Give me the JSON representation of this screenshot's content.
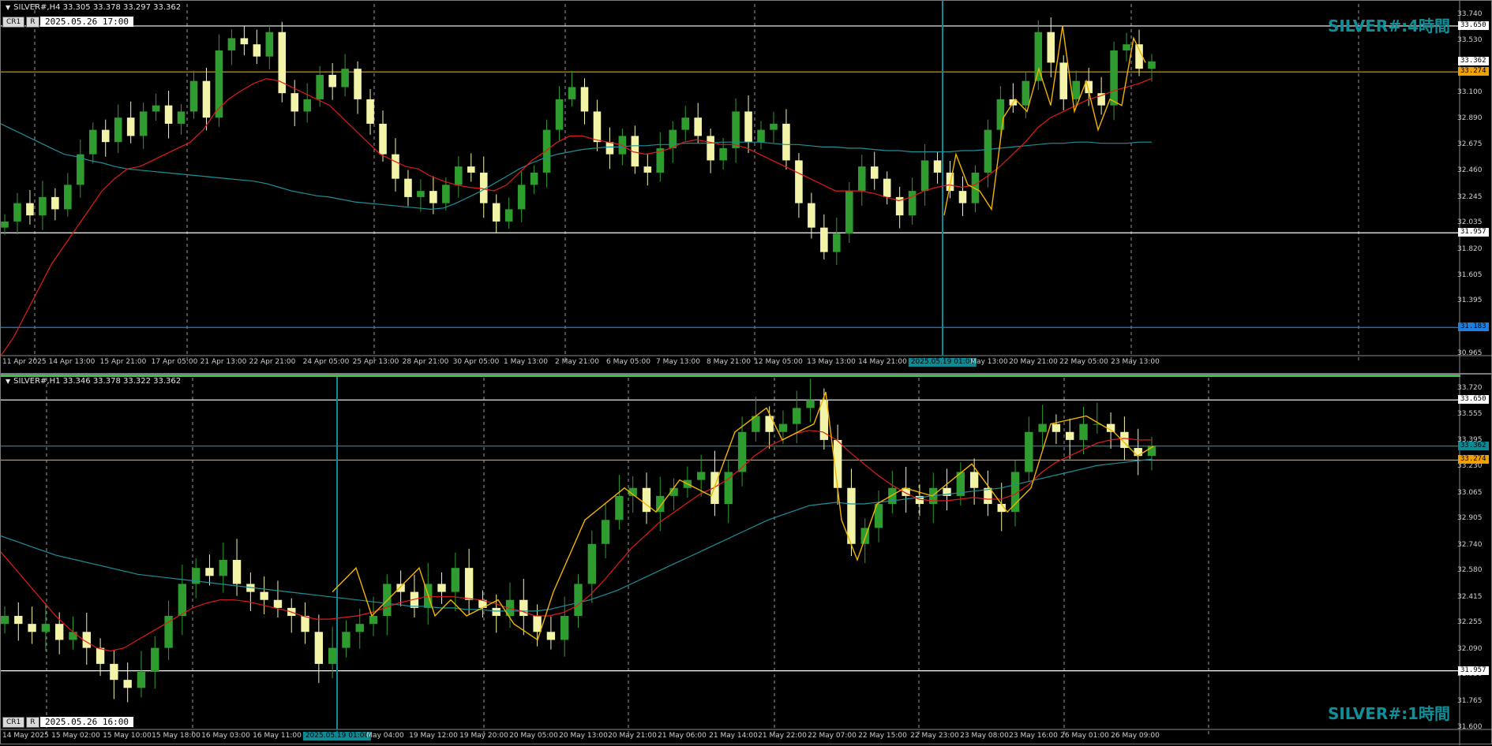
{
  "colors": {
    "background": "#000000",
    "bull_candle": "#2e9c2e",
    "bear_candle": "#f4f4a8",
    "ma_fast": "#e01b1b",
    "ma_slow": "#1f8f98",
    "zigzag": "#f0b400",
    "level_orange": "#f0a000",
    "level_white": "#ffffff",
    "level_blue": "#1e7fe0",
    "crosshair": "#0e8a95",
    "title": "#0f8f9a"
  },
  "top_chart": {
    "info": "SILVER#,H4  33.305 33.378 33.297 33.362",
    "btn_cr": "CR1",
    "btn_r": "R",
    "timestamp": "2025.05.26 17:00",
    "title": "SILVER#:4時間",
    "price_min": 30.965,
    "price_max": 33.74,
    "y_ticks": [
      "33.740",
      "33.530",
      "33.100",
      "32.890",
      "32.675",
      "32.460",
      "32.245",
      "32.035",
      "31.820",
      "31.605",
      "31.395",
      "30.965"
    ],
    "tags": [
      {
        "label": "33.650",
        "value": 33.65,
        "bg": "#ffffff",
        "fg": "#000000"
      },
      {
        "label": "33.362",
        "value": 33.362,
        "bg": "#ffffff",
        "fg": "#000000"
      },
      {
        "label": "33.274",
        "value": 33.274,
        "bg": "#f0a000",
        "fg": "#000000"
      },
      {
        "label": "31.957",
        "value": 31.957,
        "bg": "#ffffff",
        "fg": "#000000"
      },
      {
        "label": "31.183",
        "value": 31.183,
        "bg": "#1e7fe0",
        "fg": "#000000"
      }
    ],
    "levels": [
      {
        "value": 33.65,
        "color": "#ffffff"
      },
      {
        "value": 33.274,
        "color": "#f0a000"
      },
      {
        "value": 31.957,
        "color": "#ffffff"
      },
      {
        "value": 31.183,
        "color": "#1e7fe0"
      }
    ],
    "x_labels": [
      "11 Apr 2025",
      "14 Apr 13:00",
      "15 Apr 21:00",
      "17 Apr 05:00",
      "21 Apr 13:00",
      "22 Apr 21:00",
      "24 Apr 05:00",
      "25 Apr 13:00",
      "28 Apr 21:00",
      "30 Apr 05:00",
      "1 May 13:00",
      "2 May 21:00",
      "6 May 05:00",
      "7 May 13:00",
      "8 May 21:00",
      "12 May 05:00",
      "13 May 13:00",
      "14 May 21:00",
      "2025.05.19 01:00",
      "May 13:00",
      "20 May 21:00",
      "22 May 05:00",
      "23 May 13:00"
    ],
    "crosshair_label": "2025.05.19 01:00",
    "close_path": [
      32.05,
      32.2,
      32.1,
      32.25,
      32.15,
      32.35,
      32.6,
      32.8,
      32.7,
      32.9,
      32.75,
      32.95,
      33.0,
      32.85,
      32.95,
      33.2,
      32.9,
      33.45,
      33.55,
      33.5,
      33.4,
      33.6,
      33.1,
      32.95,
      33.05,
      33.25,
      33.15,
      33.3,
      33.05,
      32.85,
      32.6,
      32.4,
      32.25,
      32.3,
      32.2,
      32.35,
      32.5,
      32.45,
      32.2,
      32.05,
      32.15,
      32.35,
      32.45,
      32.8,
      33.05,
      33.15,
      32.95,
      32.7,
      32.6,
      32.75,
      32.5,
      32.45,
      32.65,
      32.8,
      32.9,
      32.75,
      32.55,
      32.65,
      32.95,
      32.7,
      32.8,
      32.85,
      32.55,
      32.2,
      32.0,
      31.8,
      31.95,
      32.3,
      32.5,
      32.4,
      32.25,
      32.1,
      32.3,
      32.55,
      32.45,
      32.3,
      32.2,
      32.45,
      32.8,
      33.05,
      33.0,
      33.2,
      33.6,
      33.35,
      33.05,
      33.2,
      33.1,
      33.0,
      33.45,
      33.5,
      33.3,
      33.36
    ],
    "ma_fast": [
      30.95,
      31.1,
      31.3,
      31.5,
      31.7,
      31.85,
      32.0,
      32.15,
      32.3,
      32.4,
      32.48,
      32.5,
      32.55,
      32.6,
      32.65,
      32.7,
      32.8,
      32.95,
      33.05,
      33.12,
      33.18,
      33.22,
      33.2,
      33.15,
      33.1,
      33.05,
      33.0,
      32.9,
      32.8,
      32.7,
      32.6,
      32.55,
      32.5,
      32.48,
      32.42,
      32.38,
      32.35,
      32.33,
      32.32,
      32.3,
      32.35,
      32.45,
      32.55,
      32.62,
      32.7,
      32.75,
      32.75,
      32.72,
      32.7,
      32.68,
      32.62,
      32.6,
      32.62,
      32.65,
      32.7,
      32.72,
      32.7,
      32.68,
      32.68,
      32.65,
      32.6,
      32.55,
      32.5,
      32.45,
      32.4,
      32.35,
      32.3,
      32.3,
      32.3,
      32.28,
      32.25,
      32.22,
      32.25,
      32.3,
      32.33,
      32.35,
      32.33,
      32.35,
      32.42,
      32.5,
      32.6,
      32.7,
      32.82,
      32.9,
      32.95,
      33.0,
      33.05,
      33.08,
      33.12,
      33.15,
      33.18,
      33.22
    ],
    "ma_slow": [
      32.85,
      32.8,
      32.75,
      32.7,
      32.65,
      32.6,
      32.58,
      32.55,
      32.53,
      32.5,
      32.48,
      32.47,
      32.46,
      32.45,
      32.44,
      32.43,
      32.42,
      32.41,
      32.4,
      32.39,
      32.38,
      32.36,
      32.33,
      32.3,
      32.28,
      32.26,
      32.25,
      32.23,
      32.21,
      32.2,
      32.19,
      32.18,
      32.17,
      32.16,
      32.15,
      32.16,
      32.2,
      32.25,
      32.3,
      32.36,
      32.42,
      32.48,
      32.53,
      32.57,
      32.6,
      32.62,
      32.64,
      32.65,
      32.66,
      32.66,
      32.67,
      32.67,
      32.68,
      32.68,
      32.69,
      32.69,
      32.69,
      32.7,
      32.7,
      32.7,
      32.7,
      32.69,
      32.68,
      32.68,
      32.67,
      32.66,
      32.66,
      32.65,
      32.65,
      32.64,
      32.63,
      32.63,
      32.62,
      32.62,
      32.62,
      32.62,
      32.63,
      32.63,
      32.64,
      32.65,
      32.66,
      32.67,
      32.68,
      32.69,
      32.69,
      32.7,
      32.7,
      32.69,
      32.69,
      32.69,
      32.7,
      32.7
    ],
    "zigzag": [
      [
        1195,
        32.1
      ],
      [
        1210,
        32.6
      ],
      [
        1225,
        32.35
      ],
      [
        1240,
        32.3
      ],
      [
        1255,
        32.15
      ],
      [
        1270,
        32.9
      ],
      [
        1285,
        33.05
      ],
      [
        1300,
        32.95
      ],
      [
        1315,
        33.3
      ],
      [
        1330,
        33.0
      ],
      [
        1345,
        33.65
      ],
      [
        1360,
        32.95
      ],
      [
        1375,
        33.2
      ],
      [
        1390,
        32.8
      ],
      [
        1405,
        33.05
      ],
      [
        1420,
        33.0
      ],
      [
        1435,
        33.55
      ],
      [
        1450,
        33.35
      ]
    ]
  },
  "bottom_chart": {
    "info": "SILVER#,H1  33.346 33.378 33.322 33.362",
    "btn_cr": "CR1",
    "btn_r": "R",
    "timestamp": "2025.05.26 16:00",
    "title": "SILVER#:1時間",
    "price_min": 31.6,
    "price_max": 33.72,
    "y_ticks": [
      "33.720",
      "33.555",
      "33.395",
      "33.230",
      "33.065",
      "32.905",
      "32.740",
      "32.580",
      "32.415",
      "32.255",
      "32.090",
      "31.930",
      "31.765",
      "31.600"
    ],
    "tags": [
      {
        "label": "33.650",
        "value": 33.65,
        "bg": "#ffffff",
        "fg": "#000000"
      },
      {
        "label": "33.362",
        "value": 33.362,
        "bg": "#0e8a95",
        "fg": "#000000"
      },
      {
        "label": "33.274",
        "value": 33.274,
        "bg": "#f0a000",
        "fg": "#000000"
      },
      {
        "label": "31.957",
        "value": 31.957,
        "bg": "#ffffff",
        "fg": "#000000"
      }
    ],
    "levels": [
      {
        "value": 33.65,
        "color": "#ffffff"
      },
      {
        "value": 33.362,
        "color": "#0e8a95"
      },
      {
        "value": 33.274,
        "color": "#f0a000"
      },
      {
        "value": 31.957,
        "color": "#ffffff"
      }
    ],
    "x_labels": [
      "14 May 2025",
      "15 May 02:00",
      "15 May 10:00",
      "15 May 18:00",
      "16 May 03:00",
      "16 May 11:00",
      "2025.05.19 01:00",
      "May 04:00",
      "19 May 12:00",
      "19 May 20:00",
      "20 May 05:00",
      "20 May 13:00",
      "20 May 21:00",
      "21 May 06:00",
      "21 May 14:00",
      "21 May 22:00",
      "22 May 07:00",
      "22 May 15:00",
      "22 May 23:00",
      "23 May 08:00",
      "23 May 16:00",
      "26 May 01:00",
      "26 May 09:00"
    ],
    "crosshair_label": "2025.05.19 01:00",
    "close_path": [
      32.3,
      32.25,
      32.2,
      32.25,
      32.15,
      32.2,
      32.1,
      32.0,
      31.9,
      31.85,
      31.95,
      32.1,
      32.3,
      32.5,
      32.6,
      32.55,
      32.65,
      32.5,
      32.45,
      32.4,
      32.35,
      32.3,
      32.2,
      32.0,
      32.1,
      32.2,
      32.25,
      32.3,
      32.5,
      32.45,
      32.35,
      32.5,
      32.45,
      32.6,
      32.4,
      32.35,
      32.3,
      32.4,
      32.3,
      32.2,
      32.15,
      32.3,
      32.5,
      32.75,
      32.9,
      33.05,
      33.1,
      32.95,
      33.05,
      33.1,
      33.15,
      33.2,
      33.0,
      33.2,
      33.45,
      33.55,
      33.45,
      33.5,
      33.6,
      33.65,
      33.4,
      33.1,
      32.75,
      32.85,
      33.0,
      33.1,
      33.05,
      33.0,
      33.1,
      33.05,
      33.2,
      33.1,
      33.0,
      32.95,
      33.2,
      33.45,
      33.5,
      33.45,
      33.4,
      33.5,
      33.5,
      33.45,
      33.35,
      33.3,
      33.36
    ],
    "ma_fast": [
      32.7,
      32.6,
      32.5,
      32.4,
      32.3,
      32.22,
      32.15,
      32.1,
      32.08,
      32.1,
      32.15,
      32.2,
      32.25,
      32.3,
      32.35,
      32.38,
      32.4,
      32.4,
      32.39,
      32.37,
      32.35,
      32.33,
      32.3,
      32.28,
      32.28,
      32.29,
      32.3,
      32.32,
      32.35,
      32.38,
      32.4,
      32.42,
      32.42,
      32.42,
      32.41,
      32.4,
      32.38,
      32.35,
      32.33,
      32.3,
      32.3,
      32.32,
      32.36,
      32.43,
      32.52,
      32.62,
      32.72,
      32.8,
      32.88,
      32.94,
      33.0,
      33.06,
      33.1,
      33.15,
      33.22,
      33.3,
      33.36,
      33.4,
      33.44,
      33.46,
      33.45,
      33.4,
      33.32,
      33.25,
      33.18,
      33.12,
      33.07,
      33.03,
      33.02,
      33.02,
      33.03,
      33.04,
      33.03,
      33.03,
      33.06,
      33.12,
      33.2,
      33.26,
      33.3,
      33.34,
      33.38,
      33.4,
      33.41,
      33.4,
      33.4
    ],
    "ma_slow": [
      32.8,
      32.77,
      32.74,
      32.71,
      32.68,
      32.66,
      32.64,
      32.62,
      32.6,
      32.58,
      32.56,
      32.55,
      32.54,
      32.53,
      32.52,
      32.51,
      32.5,
      32.49,
      32.48,
      32.47,
      32.46,
      32.45,
      32.44,
      32.43,
      32.42,
      32.41,
      32.4,
      32.39,
      32.38,
      32.37,
      32.36,
      32.36,
      32.35,
      32.35,
      32.34,
      32.34,
      32.33,
      32.33,
      32.33,
      32.33,
      32.34,
      32.36,
      32.38,
      32.4,
      32.43,
      32.46,
      32.5,
      32.54,
      32.58,
      32.62,
      32.66,
      32.7,
      32.74,
      32.78,
      32.82,
      32.86,
      32.9,
      32.93,
      32.96,
      32.99,
      33.0,
      33.01,
      33.0,
      33.0,
      33.01,
      33.02,
      33.03,
      33.04,
      33.05,
      33.06,
      33.07,
      33.08,
      33.09,
      33.1,
      33.12,
      33.14,
      33.16,
      33.18,
      33.2,
      33.22,
      33.24,
      33.25,
      33.26,
      33.27,
      33.28
    ],
    "zigzag": [
      [
        420,
        32.45
      ],
      [
        450,
        32.6
      ],
      [
        470,
        32.3
      ],
      [
        500,
        32.45
      ],
      [
        530,
        32.6
      ],
      [
        550,
        32.3
      ],
      [
        570,
        32.4
      ],
      [
        590,
        32.3
      ],
      [
        610,
        32.35
      ],
      [
        630,
        32.4
      ],
      [
        650,
        32.25
      ],
      [
        680,
        32.15
      ],
      [
        700,
        32.45
      ],
      [
        740,
        32.9
      ],
      [
        790,
        33.1
      ],
      [
        830,
        32.95
      ],
      [
        860,
        33.15
      ],
      [
        900,
        33.05
      ],
      [
        930,
        33.45
      ],
      [
        970,
        33.6
      ],
      [
        990,
        33.4
      ],
      [
        1030,
        33.5
      ],
      [
        1045,
        33.7
      ],
      [
        1065,
        32.9
      ],
      [
        1085,
        32.65
      ],
      [
        1110,
        33.0
      ],
      [
        1145,
        33.1
      ],
      [
        1180,
        33.05
      ],
      [
        1230,
        33.25
      ],
      [
        1275,
        32.95
      ],
      [
        1305,
        33.1
      ],
      [
        1330,
        33.5
      ],
      [
        1375,
        33.55
      ],
      [
        1410,
        33.45
      ],
      [
        1440,
        33.3
      ],
      [
        1460,
        33.36
      ]
    ]
  }
}
